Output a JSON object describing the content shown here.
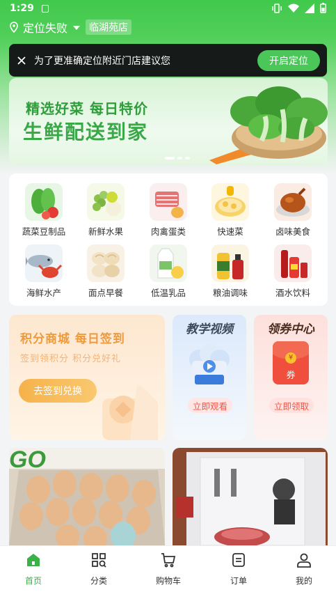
{
  "status": {
    "time": "1:29"
  },
  "location": {
    "status": "定位失败",
    "store": "临湖苑店"
  },
  "toast": {
    "message": "为了更准确定位附近门店建议您",
    "button": "开启定位"
  },
  "banner": {
    "line1": "精选好菜 每日特价",
    "line2": "生鲜配送到家"
  },
  "categories": [
    {
      "label": "蔬菜豆制品",
      "icon": "vegetable-icon"
    },
    {
      "label": "新鲜水果",
      "icon": "fruit-icon"
    },
    {
      "label": "肉禽蛋类",
      "icon": "meat-icon"
    },
    {
      "label": "快速菜",
      "icon": "quick-dish-icon"
    },
    {
      "label": "卤味美食",
      "icon": "braised-food-icon"
    },
    {
      "label": "海鲜水产",
      "icon": "seafood-icon"
    },
    {
      "label": "面点早餐",
      "icon": "breakfast-icon"
    },
    {
      "label": "低温乳品",
      "icon": "dairy-icon"
    },
    {
      "label": "粮油调味",
      "icon": "grain-oil-icon"
    },
    {
      "label": "酒水饮料",
      "icon": "drinks-icon"
    }
  ],
  "points": {
    "title": "积分商城 每日签到",
    "subtitle": "签到领积分 积分兑好礼",
    "button": "去签到兑换"
  },
  "video": {
    "title": "教学视频",
    "button": "立即观看"
  },
  "coupon": {
    "title": "领券中心",
    "button": "立即领取",
    "badge": "券"
  },
  "tabs": [
    {
      "label": "首页",
      "active": true
    },
    {
      "label": "分类",
      "active": false
    },
    {
      "label": "购物车",
      "active": false
    },
    {
      "label": "订单",
      "active": false
    },
    {
      "label": "我的",
      "active": false
    }
  ],
  "colors": {
    "brand": "#3cb14a",
    "accent_orange": "#ee9a3a",
    "red": "#e8594e"
  }
}
